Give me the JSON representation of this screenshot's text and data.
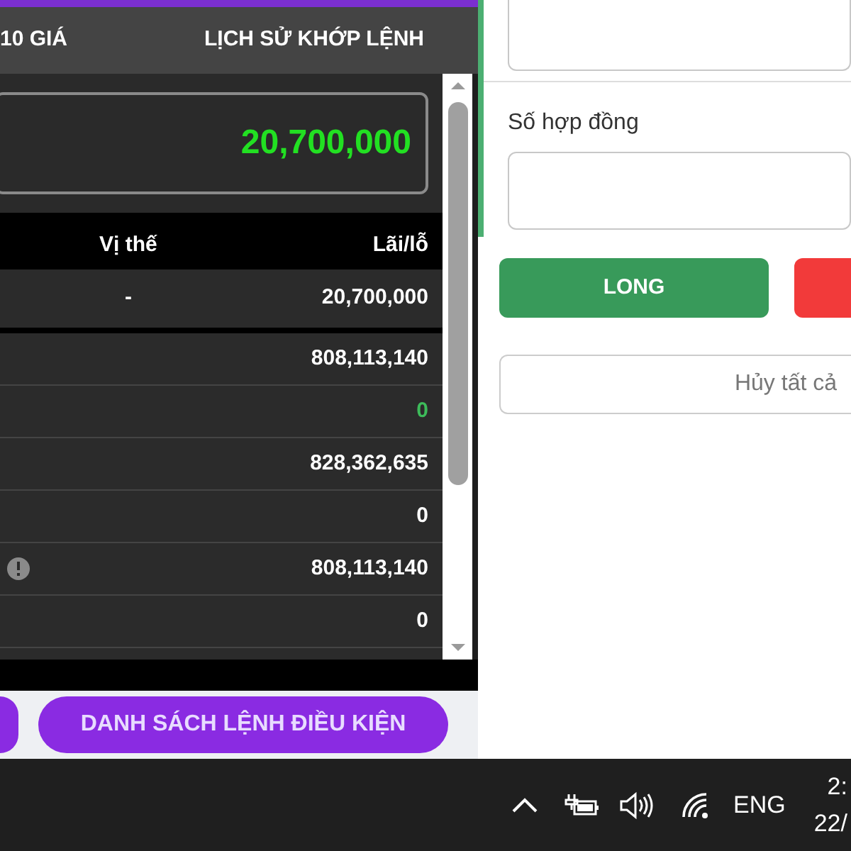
{
  "tabs": [
    {
      "label": "10 GIÁ",
      "selected": false
    },
    {
      "label": "LỊCH SỬ KHỚP LỆNH",
      "selected": false
    }
  ],
  "balance": "20,700,000",
  "table": {
    "columns": [
      "Vị thế",
      "Lãi/lỗ"
    ],
    "rows": [
      {
        "position": "-",
        "pnl": "20,700,000",
        "color": "#ffffff",
        "info": false
      },
      {
        "position": "",
        "pnl": "808,113,140",
        "color": "#ffffff",
        "info": false
      },
      {
        "position": "",
        "pnl": "0",
        "color": "#3dbb5a",
        "info": false
      },
      {
        "position": "",
        "pnl": "828,362,635",
        "color": "#ffffff",
        "info": false
      },
      {
        "position": "",
        "pnl": "0",
        "color": "#ffffff",
        "info": false
      },
      {
        "position": "",
        "pnl": "808,113,140",
        "color": "#ffffff",
        "info": true
      },
      {
        "position": "",
        "pnl": "0",
        "color": "#ffffff",
        "info": false
      }
    ]
  },
  "bottom_buttons": [
    "DANH SÁCH LỆNH ĐIỀU KIỆN"
  ],
  "order_form": {
    "contracts_label": "Số hợp đồng",
    "long_button": "LONG",
    "cancel_all_button": "Hủy tất cả"
  },
  "taskbar": {
    "language": "ENG",
    "time": "2:",
    "date": "22/"
  }
}
